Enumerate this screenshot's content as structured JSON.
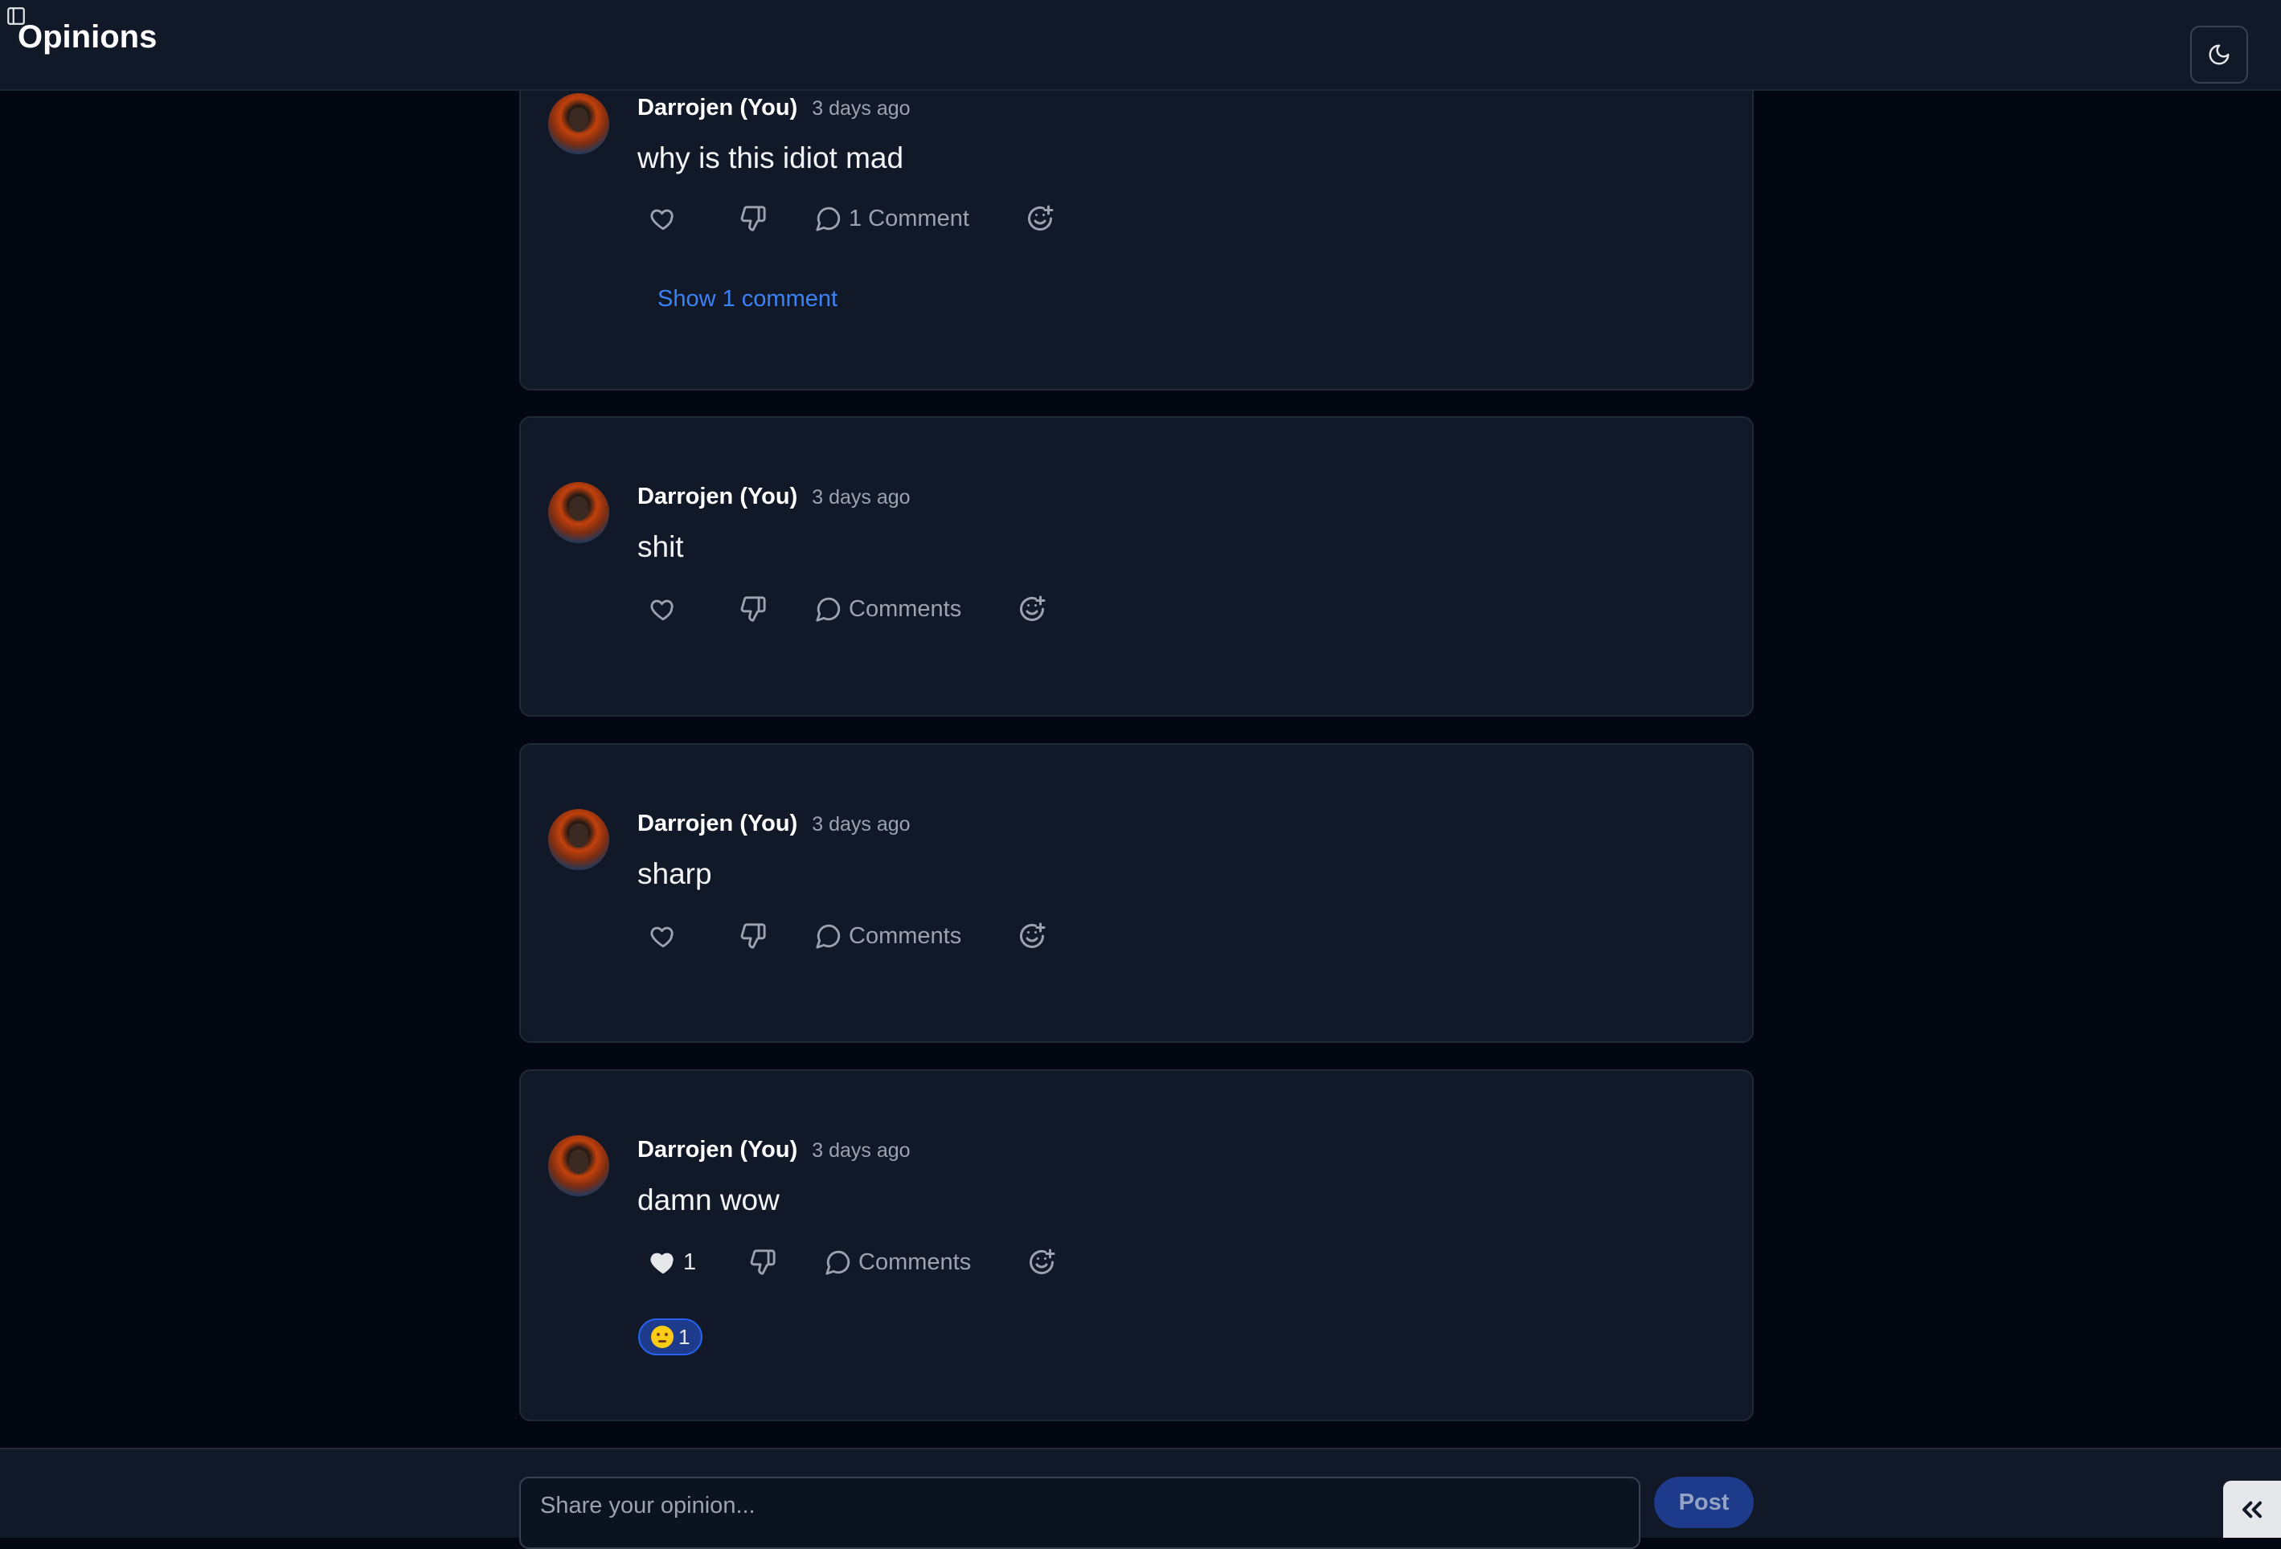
{
  "header": {
    "title": "Opinions",
    "sidebar_toggle_icon": "sidebar-icon",
    "theme_toggle_icon": "moon-icon"
  },
  "posts": [
    {
      "author": "Darrojen (You)",
      "time": "3 days ago",
      "text": "why is this idiot mad",
      "likes": "",
      "comment_label": "1 Comment",
      "show_comments_label": "Show 1 comment",
      "reactions": []
    },
    {
      "author": "Darrojen (You)",
      "time": "3 days ago",
      "text": "shit",
      "likes": "",
      "comment_label": "Comments",
      "reactions": []
    },
    {
      "author": "Darrojen (You)",
      "time": "3 days ago",
      "text": "sharp",
      "likes": "",
      "comment_label": "Comments",
      "reactions": []
    },
    {
      "author": "Darrojen (You)",
      "time": "3 days ago",
      "text": "damn wow",
      "likes": "1",
      "liked": true,
      "comment_label": "Comments",
      "reactions": [
        {
          "emoji": "thinking-face",
          "count": "1"
        }
      ]
    }
  ],
  "composer": {
    "placeholder": "Share your opinion...",
    "post_label": "Post"
  },
  "collapse_button": {
    "label": "<<"
  },
  "colors": {
    "background": "#030712",
    "surface": "#111827",
    "border": "#1f2937",
    "link": "#3b82f6",
    "button": "#1e3a8a"
  }
}
